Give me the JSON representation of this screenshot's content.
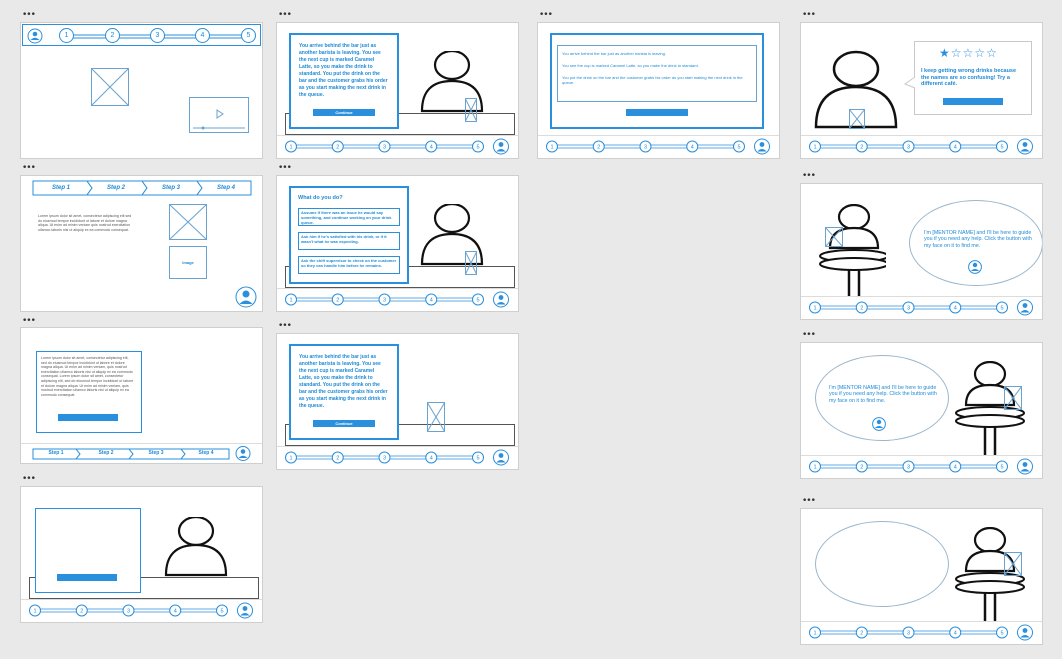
{
  "menu_dots": "•••",
  "story_text_a": "You arrive behind the bar just as another barista is leaving. You see the next cup is marked Caramel Latte, so you make the drink to standard. You put the drink on the bar and the customer grabs his order as you start making the next drink in the queue.",
  "card_button": "Continue",
  "question": "What do you do?",
  "options": [
    "Assume if there was an issue he would say something, and continue working on your drink queue.",
    "Ask him if he's satisfied with his drink, or if it wasn't what he was expecting.",
    "Ask the shift supervisor to check on the customer so they can handle him before he remains."
  ],
  "feedback_text": "I keep getting wrong drinks because the names are so confusing! Try a different café.",
  "mentor_text": "I'm [MENTOR NAME] and I'll be here to guide you if you need any help. Click the button with my face on it to find me.",
  "wide_lines": [
    "You arrive behind the bar just as another barista is leaving.",
    "You see the cup is marked Caramel Latte, so you make the drink to standard.",
    "You put the drink on the bar and the customer grabs his order as you start making the next drink in the queue."
  ],
  "steps": [
    "Step 1",
    "Step 2",
    "Step 3",
    "Step 4"
  ],
  "progress_numbers": [
    "1",
    "2",
    "3",
    "4",
    "5"
  ],
  "image_label": "Image",
  "lorem": "Lorem ipsum dolor sit amet, consectetur adipiscing elit sed do eiusmod tempor incididunt ut labore et dolore magna aliqua. Ut enim ad minim veniam quis nostrud exercitation ullamco laboris nisi ut aliquip ex ea commodo consequat.",
  "lorem_long": "Lorem ipsum dolor sit amet, consectetur adipiscing elit, sed do eiusmod tempor incididunt ut labore et dolore magna aliqua. Ut enim ad minim veniam, quis nostrud exercitation ullamco laboris nisi ut aliquip ex ea commodo consequat. Lorem ipsum dolor sit amet, consectetur adipiscing elit, sed do eiusmod tempor incididunt ut labore et dolore magna aliqua. Ut enim ad minim veniam, quis nostrud exercitation ullamco laboris nisi ut aliquip ex ea commodo consequat.",
  "rating_stars_filled": 1,
  "rating_stars_total": 5,
  "colors": {
    "accent": "#2a8fdc",
    "line": "#111111"
  }
}
